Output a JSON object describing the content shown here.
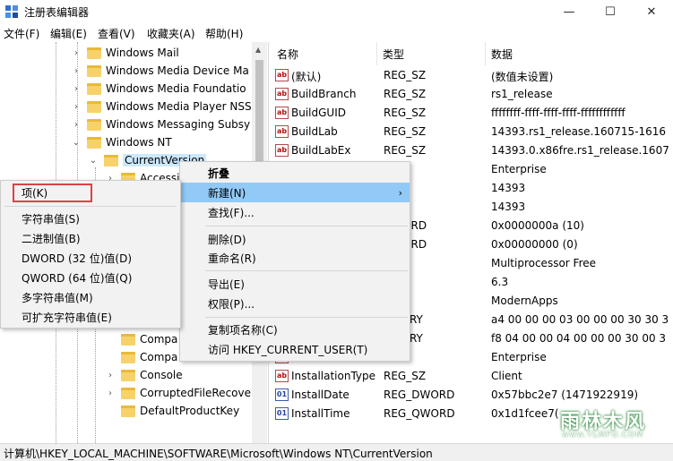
{
  "window": {
    "title": "注册表编辑器",
    "min": "—",
    "max": "☐",
    "close": "✕"
  },
  "menu": [
    "文件(F)",
    "编辑(E)",
    "查看(V)",
    "收藏夹(A)",
    "帮助(H)"
  ],
  "tree": {
    "items": [
      {
        "label": "Windows Mail"
      },
      {
        "label": "Windows Media Device Ma"
      },
      {
        "label": "Windows Media Foundatio"
      },
      {
        "label": "Windows Media Player NSS"
      },
      {
        "label": "Windows Messaging Subsy"
      },
      {
        "label": "Windows NT"
      },
      {
        "label": "CurrentVersion"
      },
      {
        "label": "Accessi"
      },
      {
        "label": "Compa"
      },
      {
        "label": "Compa"
      },
      {
        "label": "Console"
      },
      {
        "label": "CorruptedFileRecove"
      },
      {
        "label": "DefaultProductKey"
      }
    ]
  },
  "list": {
    "headers": [
      "名称",
      "类型",
      "数据"
    ],
    "rows": [
      {
        "name": "(默认)",
        "type": "REG_SZ",
        "data": "(数值未设置)"
      },
      {
        "name": "BuildBranch",
        "type": "REG_SZ",
        "data": "rs1_release"
      },
      {
        "name": "BuildGUID",
        "type": "REG_SZ",
        "data": "ffffffff-ffff-ffff-ffff-ffffffffffff"
      },
      {
        "name": "BuildLab",
        "type": "REG_SZ",
        "data": "14393.rs1_release.160715-1616"
      },
      {
        "name": "BuildLabEx",
        "type": "REG_SZ",
        "data": "14393.0.x86fre.rs1_release.1607"
      },
      {
        "name": "",
        "type": "SZ",
        "data": "Enterprise"
      },
      {
        "name": "",
        "type": "SZ",
        "data": "14393"
      },
      {
        "name": "",
        "type": "SZ",
        "data": "14393"
      },
      {
        "name": "",
        "type": "DWORD",
        "data": "0x0000000a (10)"
      },
      {
        "name": "",
        "type": "DWORD",
        "data": "0x00000000 (0)"
      },
      {
        "name": "",
        "type": "SZ",
        "data": "Multiprocessor Free"
      },
      {
        "name": "",
        "type": "SZ",
        "data": "6.3"
      },
      {
        "name": "",
        "type": "SZ",
        "data": "ModernApps"
      },
      {
        "name": "",
        "type": "BINARY",
        "data": "a4 00 00 00 03 00 00 00 30 30 3"
      },
      {
        "name": "",
        "type": "BINARY",
        "data": "f8 04 00 00 04 00 00 00 30 00 3"
      },
      {
        "name": "",
        "type": "SZ",
        "data": "Enterprise"
      },
      {
        "name": "InstallationType",
        "type": "REG_SZ",
        "data": "Client"
      },
      {
        "name": "InstallDate",
        "type": "REG_DWORD",
        "data": "0x57bbc2e7 (1471922919)"
      },
      {
        "name": "InstallTime",
        "type": "REG_QWORD",
        "data": "0x1d1fcee7("
      }
    ]
  },
  "context_main": {
    "items": [
      "折叠",
      "新建(N)",
      "查找(F)...",
      "删除(D)",
      "重命名(R)",
      "导出(E)",
      "权限(P)...",
      "复制项名称(C)",
      "访问 HKEY_CURRENT_USER(T)"
    ]
  },
  "context_new": {
    "items": [
      "项(K)",
      "字符串值(S)",
      "二进制值(B)",
      "DWORD (32 位)值(D)",
      "QWORD (64 位)值(Q)",
      "多字符串值(M)",
      "可扩充字符串值(E)"
    ]
  },
  "status": {
    "path": "计算机\\HKEY_LOCAL_MACHINE\\SOFTWARE\\Microsoft\\Windows NT\\CurrentVersion"
  },
  "watermark": {
    "main": "雨林木风",
    "sub": "www.YLMFU.COM"
  },
  "colors": {
    "highlight": "#91c9f7",
    "selection": "#cce8ff",
    "redbox": "#e04040",
    "folder": "#f7d26b"
  }
}
